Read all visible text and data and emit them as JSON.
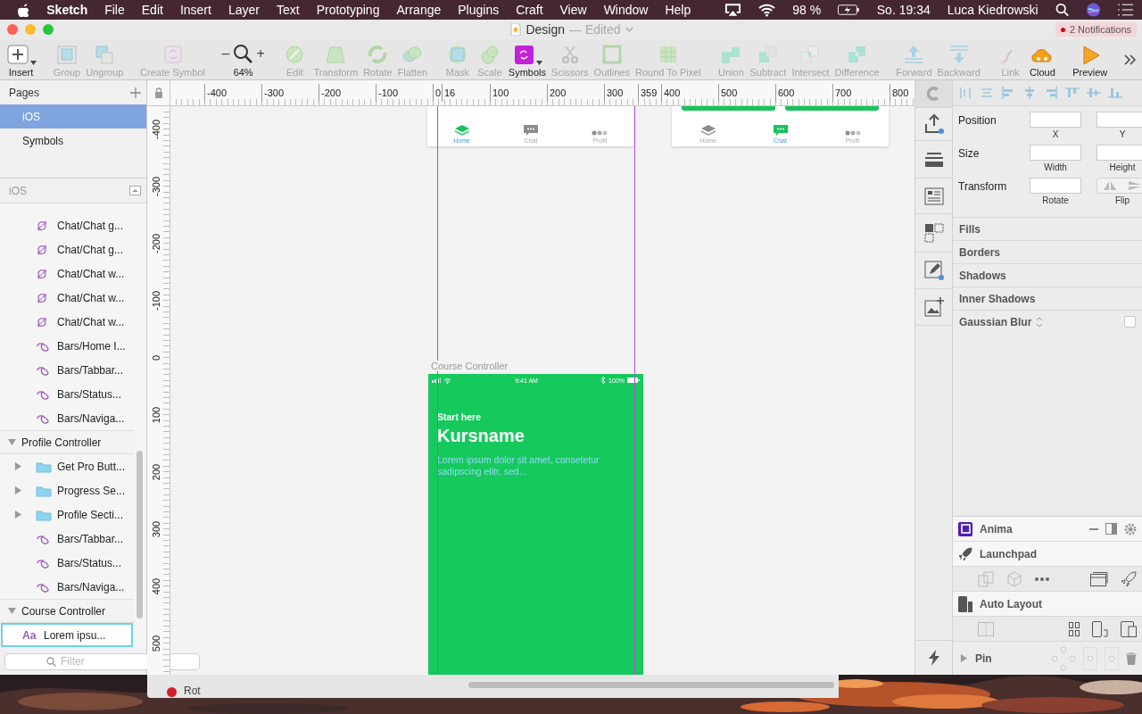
{
  "menu_bar": {
    "app": "Sketch",
    "menus": [
      "File",
      "Edit",
      "Insert",
      "Layer",
      "Text",
      "Prototyping",
      "Arrange",
      "Plugins",
      "Craft",
      "View",
      "Window",
      "Help"
    ],
    "battery": "98 %",
    "clock": "So. 19:34",
    "user": "Luca Kiedrowski"
  },
  "window": {
    "title": "Design",
    "status": "— Edited",
    "notifications": "2 Notifications"
  },
  "toolbar": [
    {
      "items": [
        {
          "kind": "tool",
          "label": "Insert",
          "disabled": false
        }
      ]
    },
    {
      "items": [
        {
          "kind": "tool",
          "label": "Group",
          "disabled": true
        },
        {
          "kind": "tool",
          "label": "Ungroup",
          "disabled": true
        }
      ]
    },
    {
      "items": [
        {
          "kind": "tool",
          "label": "Create Symbol",
          "disabled": true
        }
      ]
    },
    {
      "items": [
        {
          "kind": "zoom",
          "label": "64%",
          "minus": "–",
          "plus": "+"
        }
      ]
    },
    {
      "items": [
        {
          "kind": "tool",
          "label": "Edit",
          "disabled": true
        },
        {
          "kind": "tool",
          "label": "Transform",
          "disabled": true
        },
        {
          "kind": "tool",
          "label": "Rotate",
          "disabled": true
        },
        {
          "kind": "tool",
          "label": "Flatten",
          "disabled": true
        }
      ]
    },
    {
      "items": [
        {
          "kind": "tool",
          "label": "Mask",
          "disabled": true
        },
        {
          "kind": "tool",
          "label": "Scale",
          "disabled": true
        },
        {
          "kind": "tool",
          "label": "Symbols",
          "disabled": false
        },
        {
          "kind": "tool",
          "label": "Scissors",
          "disabled": true
        },
        {
          "kind": "tool",
          "label": "Outlines",
          "disabled": true
        },
        {
          "kind": "tool",
          "label": "Round To Pixel",
          "disabled": true
        }
      ]
    },
    {
      "items": [
        {
          "kind": "tool",
          "label": "Union",
          "disabled": true
        },
        {
          "kind": "tool",
          "label": "Subtract",
          "disabled": true
        },
        {
          "kind": "tool",
          "label": "Intersect",
          "disabled": true
        },
        {
          "kind": "tool",
          "label": "Difference",
          "disabled": true
        }
      ]
    },
    {
      "items": [
        {
          "kind": "tool",
          "label": "Forward",
          "disabled": true
        },
        {
          "kind": "tool",
          "label": "Backward",
          "disabled": true
        }
      ]
    },
    {
      "items": [
        {
          "kind": "tool",
          "label": "Link",
          "disabled": true
        },
        {
          "kind": "tool",
          "label": "Cloud",
          "disabled": false
        }
      ]
    },
    {
      "items": [
        {
          "kind": "tool",
          "label": "Preview",
          "disabled": false
        }
      ]
    }
  ],
  "pages": {
    "title": "Pages",
    "items": [
      {
        "label": "iOS",
        "selected": true
      },
      {
        "label": "Symbols",
        "selected": false
      }
    ]
  },
  "layers": {
    "title": "iOS",
    "groups": [
      {
        "children": [
          {
            "kind": "symbol",
            "label": "Chat/Chat g...",
            "selected": false
          },
          {
            "kind": "symbol",
            "label": "Chat/Chat g...",
            "selected": false
          },
          {
            "kind": "symbol",
            "label": "Chat/Chat w...",
            "selected": false
          },
          {
            "kind": "symbol",
            "label": "Chat/Chat w...",
            "selected": false
          },
          {
            "kind": "symbol",
            "label": "Chat/Chat w...",
            "selected": false
          },
          {
            "kind": "instance",
            "label": "Bars/Home I...",
            "selected": false
          },
          {
            "kind": "instance",
            "label": "Bars/Tabbar...",
            "selected": false
          },
          {
            "kind": "instance",
            "label": "Bars/Status...",
            "selected": false
          },
          {
            "kind": "instance",
            "label": "Bars/Naviga...",
            "selected": false
          }
        ]
      },
      {
        "label": "Profile Controller",
        "expanded": true,
        "children": [
          {
            "kind": "folder",
            "label": "Get Pro Butt...",
            "expanded": false,
            "selected": false
          },
          {
            "kind": "folder",
            "label": "Progress Se...",
            "expanded": false,
            "selected": false
          },
          {
            "kind": "folder",
            "label": "Profile Secti...",
            "expanded": false,
            "selected": false
          },
          {
            "kind": "instance",
            "label": "Bars/Tabbar...",
            "selected": false
          },
          {
            "kind": "instance",
            "label": "Bars/Status...",
            "selected": false
          },
          {
            "kind": "instance",
            "label": "Bars/Naviga...",
            "selected": false
          }
        ]
      },
      {
        "label": "Course Controller",
        "expanded": true,
        "children": [
          {
            "kind": "text",
            "glyph": "Aa",
            "label": "Lorem ipsu...",
            "selected": true
          }
        ]
      }
    ]
  },
  "filter": {
    "placeholder": "Filter"
  },
  "canvas": {
    "h_ruler": [
      "-400",
      "-300",
      "-200",
      "-100",
      "0",
      "16",
      "100",
      "200",
      "300",
      "359",
      "400",
      "500",
      "600",
      "700",
      "800"
    ],
    "v_ruler": [
      "-400",
      "-300",
      "-200",
      "-100",
      "0",
      "100",
      "200",
      "300",
      "400",
      "500"
    ],
    "tab_bars": [
      {
        "tabs": [
          {
            "label": "Home",
            "selected": true
          },
          {
            "label": "Chat",
            "selected": false
          },
          {
            "label": "Profil",
            "selected": false
          }
        ]
      },
      {
        "tabs": [
          {
            "label": "Home",
            "selected": false
          },
          {
            "label": "Chat",
            "selected": true
          },
          {
            "label": "Profil",
            "selected": false
          }
        ]
      }
    ],
    "artboard": {
      "name": "Course Controller",
      "time": "9:41 AM",
      "battery": "100%",
      "eyebrow": "Start here",
      "title": "Kursname",
      "body": "Lorem ipsum dolor sit amet, consetetur sadipscing elitr, sed..."
    }
  },
  "inspector": {
    "rows": [
      {
        "label": "Position",
        "fields": [
          {
            "kind": "input",
            "caption": "X"
          },
          {
            "kind": "input",
            "caption": "Y"
          }
        ]
      },
      {
        "label": "Size",
        "fields": [
          {
            "kind": "input",
            "caption": "Width"
          },
          {
            "kind": "input",
            "caption": "Height"
          }
        ]
      },
      {
        "label": "Transform",
        "fields": [
          {
            "kind": "input",
            "caption": "Rotate"
          },
          {
            "kind": "flip",
            "caption": "Flip"
          }
        ]
      }
    ],
    "sections": [
      {
        "kind": "plain",
        "label": "Fills"
      },
      {
        "kind": "plain",
        "label": "Borders"
      },
      {
        "kind": "plain",
        "label": "Shadows"
      },
      {
        "kind": "plain",
        "label": "Inner Shadows"
      },
      {
        "kind": "blur",
        "label": "Gaussian Blur",
        "checked": false
      }
    ],
    "plugins": {
      "anima": "Anima",
      "launchpad": "Launchpad",
      "auto_layout": "Auto Layout"
    },
    "pin": {
      "label": "Pin",
      "expanded": false
    }
  },
  "desktop": {
    "window_label": "Rot"
  }
}
